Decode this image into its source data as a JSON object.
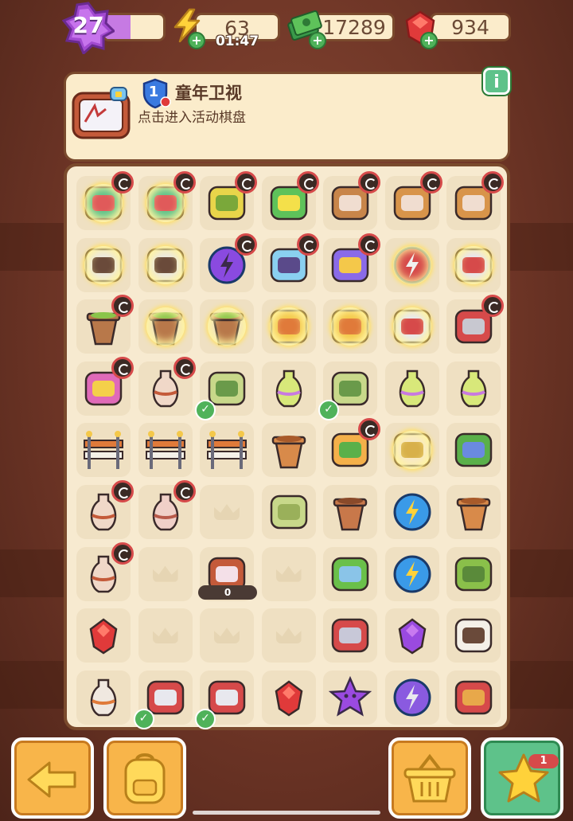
{
  "topbar": {
    "level": "27",
    "xp_progress": 0.45,
    "energy": "63",
    "energy_timer": "01:47",
    "cash": "17289",
    "gems": "934"
  },
  "event": {
    "badge_number": "1",
    "title": "童年卫视",
    "subtitle": "点击进入活动棋盘",
    "info_label": "i"
  },
  "board": {
    "columns": 7,
    "rows": 9,
    "cells": [
      {
        "item": "medkit-icon",
        "lock": true,
        "glow": true
      },
      {
        "item": "medkit-icon",
        "lock": true,
        "glow": true
      },
      {
        "item": "bucket-icon",
        "lock": true
      },
      {
        "item": "cash-stack-icon",
        "lock": true
      },
      {
        "item": "bowls-box-icon",
        "lock": true
      },
      {
        "item": "crate-icon",
        "lock": true
      },
      {
        "item": "crate-icon",
        "lock": true
      },
      {
        "item": "hex-badge-icon",
        "glow": true
      },
      {
        "item": "hex-badge-icon",
        "glow": true
      },
      {
        "item": "motorbike-icon",
        "lock": true
      },
      {
        "item": "jetski-icon",
        "lock": true
      },
      {
        "item": "car-icon",
        "lock": true
      },
      {
        "item": "ball-icon",
        "glow": true
      },
      {
        "item": "ornament-icon",
        "glow": true
      },
      {
        "item": "pot-icon",
        "lock": true
      },
      {
        "item": "pot-icon",
        "glow": true
      },
      {
        "item": "pot-icon",
        "glow": true
      },
      {
        "item": "trophy-icon",
        "glow": true
      },
      {
        "item": "trophy-icon",
        "glow": true
      },
      {
        "item": "tools-icon",
        "glow": true
      },
      {
        "item": "toolbox-icon",
        "lock": true
      },
      {
        "item": "flower-basket-icon",
        "lock": true
      },
      {
        "item": "vase-icon",
        "lock": true
      },
      {
        "item": "broom-icon",
        "check": true
      },
      {
        "item": "spray-bottle-icon"
      },
      {
        "item": "broom-icon",
        "check": true
      },
      {
        "item": "spray-bottle-icon"
      },
      {
        "item": "spray-bottle-icon"
      },
      {
        "item": "barrier-icon"
      },
      {
        "item": "barrier-icon"
      },
      {
        "item": "barrier-icon"
      },
      {
        "item": "flowerpot-icon"
      },
      {
        "item": "plant-box-icon",
        "lock": true
      },
      {
        "item": "gift-box-icon",
        "glow": true
      },
      {
        "item": "rake-icon"
      },
      {
        "item": "vase-icon",
        "lock": true
      },
      {
        "item": "jar-icon",
        "lock": true
      },
      {
        "item": "empty"
      },
      {
        "item": "soap-icon"
      },
      {
        "item": "broken-pot-icon"
      },
      {
        "item": "energy-orb-icon"
      },
      {
        "item": "flowerpot-icon"
      },
      {
        "item": "vase-icon",
        "lock": true
      },
      {
        "item": "empty"
      },
      {
        "item": "tv-chest-icon",
        "counter": "0"
      },
      {
        "item": "empty"
      },
      {
        "item": "dustpan-icon"
      },
      {
        "item": "energy-orb-icon"
      },
      {
        "item": "mat-icon"
      },
      {
        "item": "ruby-cluster-icon"
      },
      {
        "item": "empty"
      },
      {
        "item": "empty"
      },
      {
        "item": "empty"
      },
      {
        "item": "garden-fork-icon"
      },
      {
        "item": "purple-gem-icon"
      },
      {
        "item": "seed-bag-icon"
      },
      {
        "item": "bottle-icon"
      },
      {
        "item": "pruner-icon",
        "check": true
      },
      {
        "item": "pruner-icon",
        "check": true
      },
      {
        "item": "ruby-icon"
      },
      {
        "item": "purple-star-icon"
      },
      {
        "item": "crystal-ball-icon"
      },
      {
        "item": "brush-icon"
      }
    ]
  },
  "bottom": {
    "star_badge": "1"
  },
  "colors": {
    "accent_green": "#5ec28a",
    "accent_orange": "#f8b54a",
    "lock_red": "#d64a4a",
    "panel_bg": "#fbeccb",
    "border_brown": "#7a4a2d"
  }
}
